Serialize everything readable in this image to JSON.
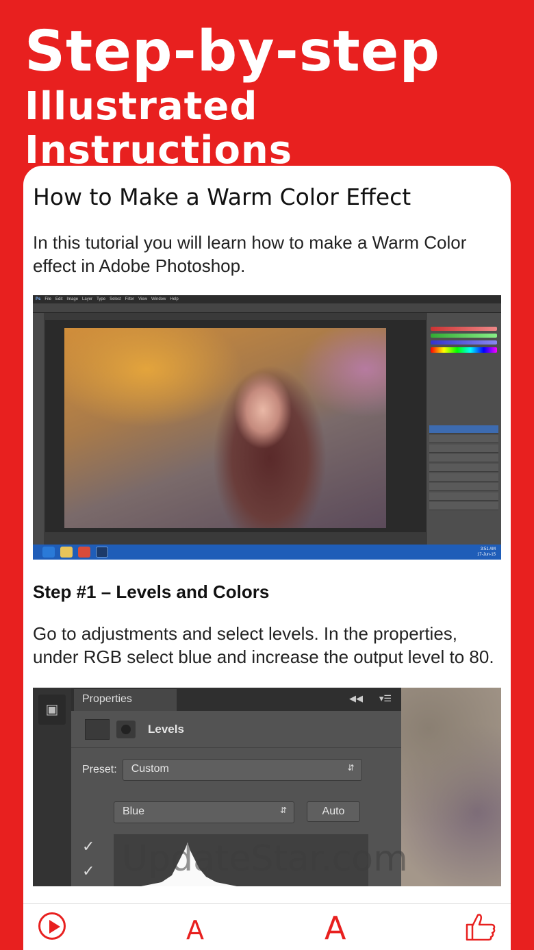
{
  "hero": {
    "line1": "Step-by-step",
    "line2": "Illustrated Instructions"
  },
  "article": {
    "title": "How to Make a Warm Color Effect",
    "intro": "In this tutorial you will learn how to make a Warm Color effect in Adobe Photoshop.",
    "step1": {
      "title": "Step #1 – Levels and Colors",
      "body": "Go to adjustments and select levels. In the properties, under RGB select blue and increase the output level to 80."
    }
  },
  "screenshot1": {
    "app_logo": "Ps",
    "menu": [
      "File",
      "Edit",
      "Image",
      "Layer",
      "Type",
      "Select",
      "Filter",
      "View",
      "Window",
      "Help"
    ],
    "taskbar_time": "3:51 AM",
    "taskbar_date": "17-Jun-15"
  },
  "screenshot2": {
    "panel_tab": "Properties",
    "adjustment": "Levels",
    "preset_label": "Preset:",
    "preset_value": "Custom",
    "channel_value": "Blue",
    "auto_label": "Auto",
    "watermark": "UpdateStar.com"
  },
  "bottom_bar": {
    "font_small": "A",
    "font_large": "A",
    "icons": [
      "play-icon",
      "font-smaller-icon",
      "font-larger-icon",
      "thumbs-up-icon"
    ]
  },
  "colors": {
    "brand": "#e8201f",
    "card": "#ffffff"
  }
}
